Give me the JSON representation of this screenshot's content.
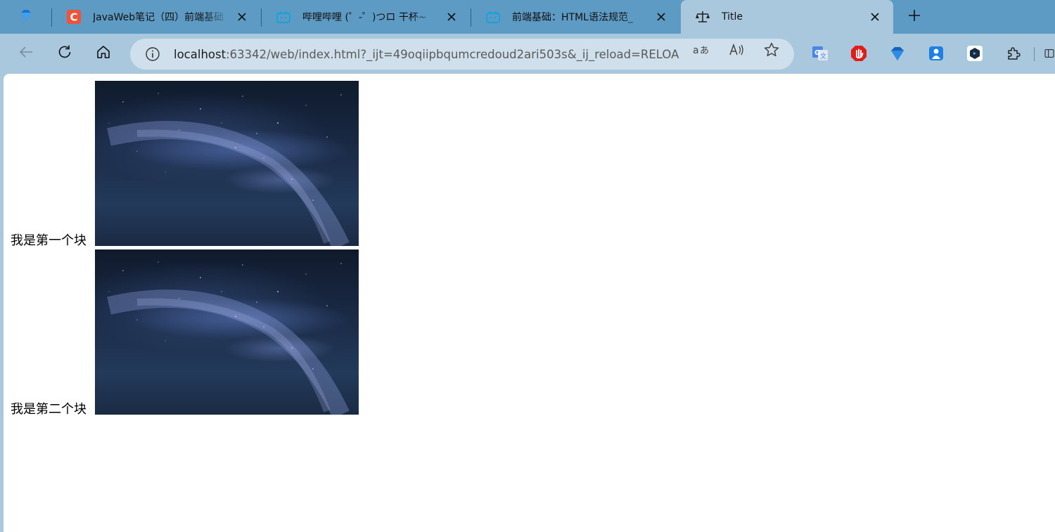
{
  "tabs": [
    {
      "title": "JavaWeb笔记（四）前端基础",
      "favicon": "csdn-c-icon",
      "active": false
    },
    {
      "title": "哔哩哔哩 (゜-゜)つロ 干杯~",
      "favicon": "bilibili-tv-icon",
      "active": false
    },
    {
      "title": "前端基础：HTML语法规范_",
      "favicon": "bilibili-tv-icon",
      "active": false
    },
    {
      "title": "Title",
      "favicon": "scale-icon",
      "active": true
    }
  ],
  "address": {
    "host": "localhost",
    "rest": ":63342/web/index.html?_ijt=49oqiipbqumcredoud2ari503s&_ij_reload=RELOAD_O..."
  },
  "page": {
    "blocks": [
      {
        "label": "我是第一个块"
      },
      {
        "label": "我是第二个块"
      }
    ]
  },
  "colors": {
    "tabstrip": "#5d9bc4",
    "toolbar": "#a9c7dd",
    "addressbar": "#cfe0ec",
    "page_bg": "#ffffff"
  }
}
